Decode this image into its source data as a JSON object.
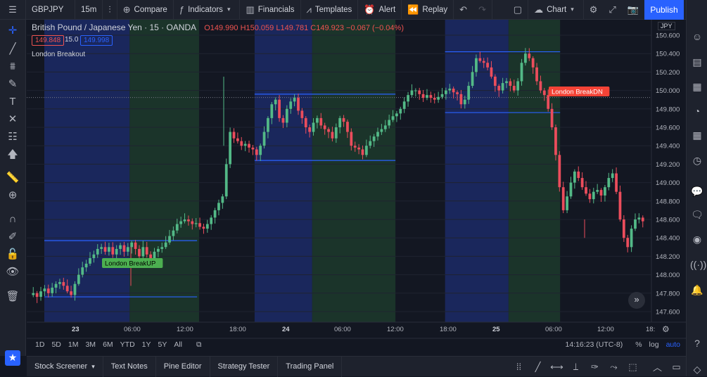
{
  "topbar": {
    "symbol": "GBPJPY",
    "interval": "15m",
    "compare": "Compare",
    "indicators": "Indicators",
    "financials": "Financials",
    "templates": "Templates",
    "alert": "Alert",
    "replay": "Replay",
    "chart_layout": "Chart",
    "publish": "Publish"
  },
  "legend": {
    "title": "British Pound / Japanese Yen · 15 · OANDA",
    "ohlc": "O149.990 H150.059 L149.781 C149.923 −0.067 (−0.04%)",
    "bid": "149.848",
    "spread": "15.0",
    "ask": "149.998",
    "indicator_name": "London Breakout"
  },
  "currency": "JPY",
  "price_axis": [
    "150.600",
    "150.400",
    "150.200",
    "150.000",
    "149.800",
    "149.600",
    "149.400",
    "149.200",
    "149.000",
    "148.800",
    "148.600",
    "148.400",
    "148.200",
    "148.000",
    "147.800",
    "147.600"
  ],
  "time_axis": [
    {
      "label": "23",
      "bold": true
    },
    {
      "label": "06:00"
    },
    {
      "label": "12:00"
    },
    {
      "label": "18:00"
    },
    {
      "label": "24",
      "bold": true
    },
    {
      "label": "06:00"
    },
    {
      "label": "12:00"
    },
    {
      "label": "18:00"
    },
    {
      "label": "25",
      "bold": true
    },
    {
      "label": "06:00"
    },
    {
      "label": "12:00"
    },
    {
      "label": "18:"
    }
  ],
  "signals": {
    "up_label": "London BreakUP",
    "down_label": "London BreakDN",
    "up_color": "#4caf50",
    "down_color": "#f44336"
  },
  "colors": {
    "bull": "#26a69a",
    "bear": "#ef5350",
    "bull_candle": "#53b987",
    "bear_candle": "#eb4d5c",
    "session_blue": "#1c2a66",
    "session_green": "#1d3a2b",
    "range_line": "#2962ff"
  },
  "timeframes": [
    "1D",
    "5D",
    "1M",
    "3M",
    "6M",
    "YTD",
    "1Y",
    "5Y",
    "All"
  ],
  "clock": "14:16:23 (UTC-8)",
  "scale": {
    "percent": "%",
    "log": "log",
    "auto": "auto"
  },
  "bottom_tabs": [
    "Stock Screener",
    "Text Notes",
    "Pine Editor",
    "Strategy Tester",
    "Trading Panel"
  ],
  "chart_data": {
    "type": "candlestick",
    "price_min": 147.5,
    "price_max": 150.7,
    "sessions": [
      {
        "blue": [
          0.0,
          0.43
        ],
        "green": [
          0.43,
          0.78
        ]
      },
      {
        "blue": [
          1.06,
          1.35
        ],
        "green": [
          1.35,
          1.77
        ]
      },
      {
        "blue": [
          2.02,
          2.34
        ],
        "green": [
          2.34,
          2.6
        ]
      }
    ],
    "ranges": [
      {
        "x0": 0.0,
        "x1": 0.77,
        "high": 148.37,
        "low": 147.76
      },
      {
        "x0": 1.06,
        "x1": 1.77,
        "high": 149.96,
        "low": 149.24
      },
      {
        "x0": 2.02,
        "x1": 2.6,
        "high": 150.42,
        "low": 149.76
      }
    ],
    "path": [
      147.78,
      147.8,
      147.76,
      147.82,
      147.85,
      147.8,
      147.86,
      147.9,
      147.92,
      147.88,
      147.82,
      147.78,
      147.9,
      148.0,
      148.08,
      148.12,
      148.18,
      148.22,
      148.28,
      148.3,
      148.25,
      148.3,
      148.22,
      148.28,
      148.32,
      148.25,
      148.3,
      148.35,
      148.28,
      148.2,
      148.3,
      148.22,
      148.18,
      148.25,
      148.28,
      148.3,
      148.35,
      148.42,
      148.48,
      148.55,
      148.58,
      148.6,
      148.58,
      148.55,
      148.56,
      148.52,
      148.5,
      148.55,
      148.62,
      148.7,
      148.78,
      148.85,
      149.2,
      149.55,
      149.48,
      149.45,
      149.4,
      149.42,
      149.38,
      149.36,
      149.3,
      149.4,
      149.55,
      149.7,
      149.85,
      149.9,
      149.7,
      149.65,
      149.8,
      149.88,
      149.92,
      149.78,
      149.7,
      149.6,
      149.55,
      149.65,
      149.7,
      149.62,
      149.58,
      149.55,
      149.48,
      149.6,
      149.7,
      149.66,
      149.55,
      149.4,
      149.38,
      149.36,
      149.3,
      149.4,
      149.45,
      149.5,
      149.55,
      149.58,
      149.62,
      149.68,
      149.72,
      149.75,
      149.8,
      149.88,
      149.95,
      150.0,
      150.0,
      149.96,
      149.92,
      149.95,
      149.92,
      149.9,
      149.93,
      149.96,
      150.0,
      150.02,
      149.98,
      149.96,
      149.85,
      149.9,
      150.05,
      150.2,
      150.35,
      150.32,
      150.3,
      150.25,
      150.15,
      150.05,
      150.0,
      150.08,
      150.1,
      150.05,
      150.0,
      150.1,
      150.3,
      150.4,
      150.35,
      150.25,
      150.1,
      150.0,
      149.95,
      149.8,
      149.6,
      149.3,
      148.95,
      148.7,
      148.85,
      149.0,
      149.12,
      149.05,
      148.95,
      148.88,
      148.82,
      148.9,
      148.92,
      148.86,
      148.95,
      149.05,
      149.1,
      148.9,
      148.6,
      148.4,
      148.3,
      148.5,
      148.6,
      148.62,
      148.58
    ]
  }
}
